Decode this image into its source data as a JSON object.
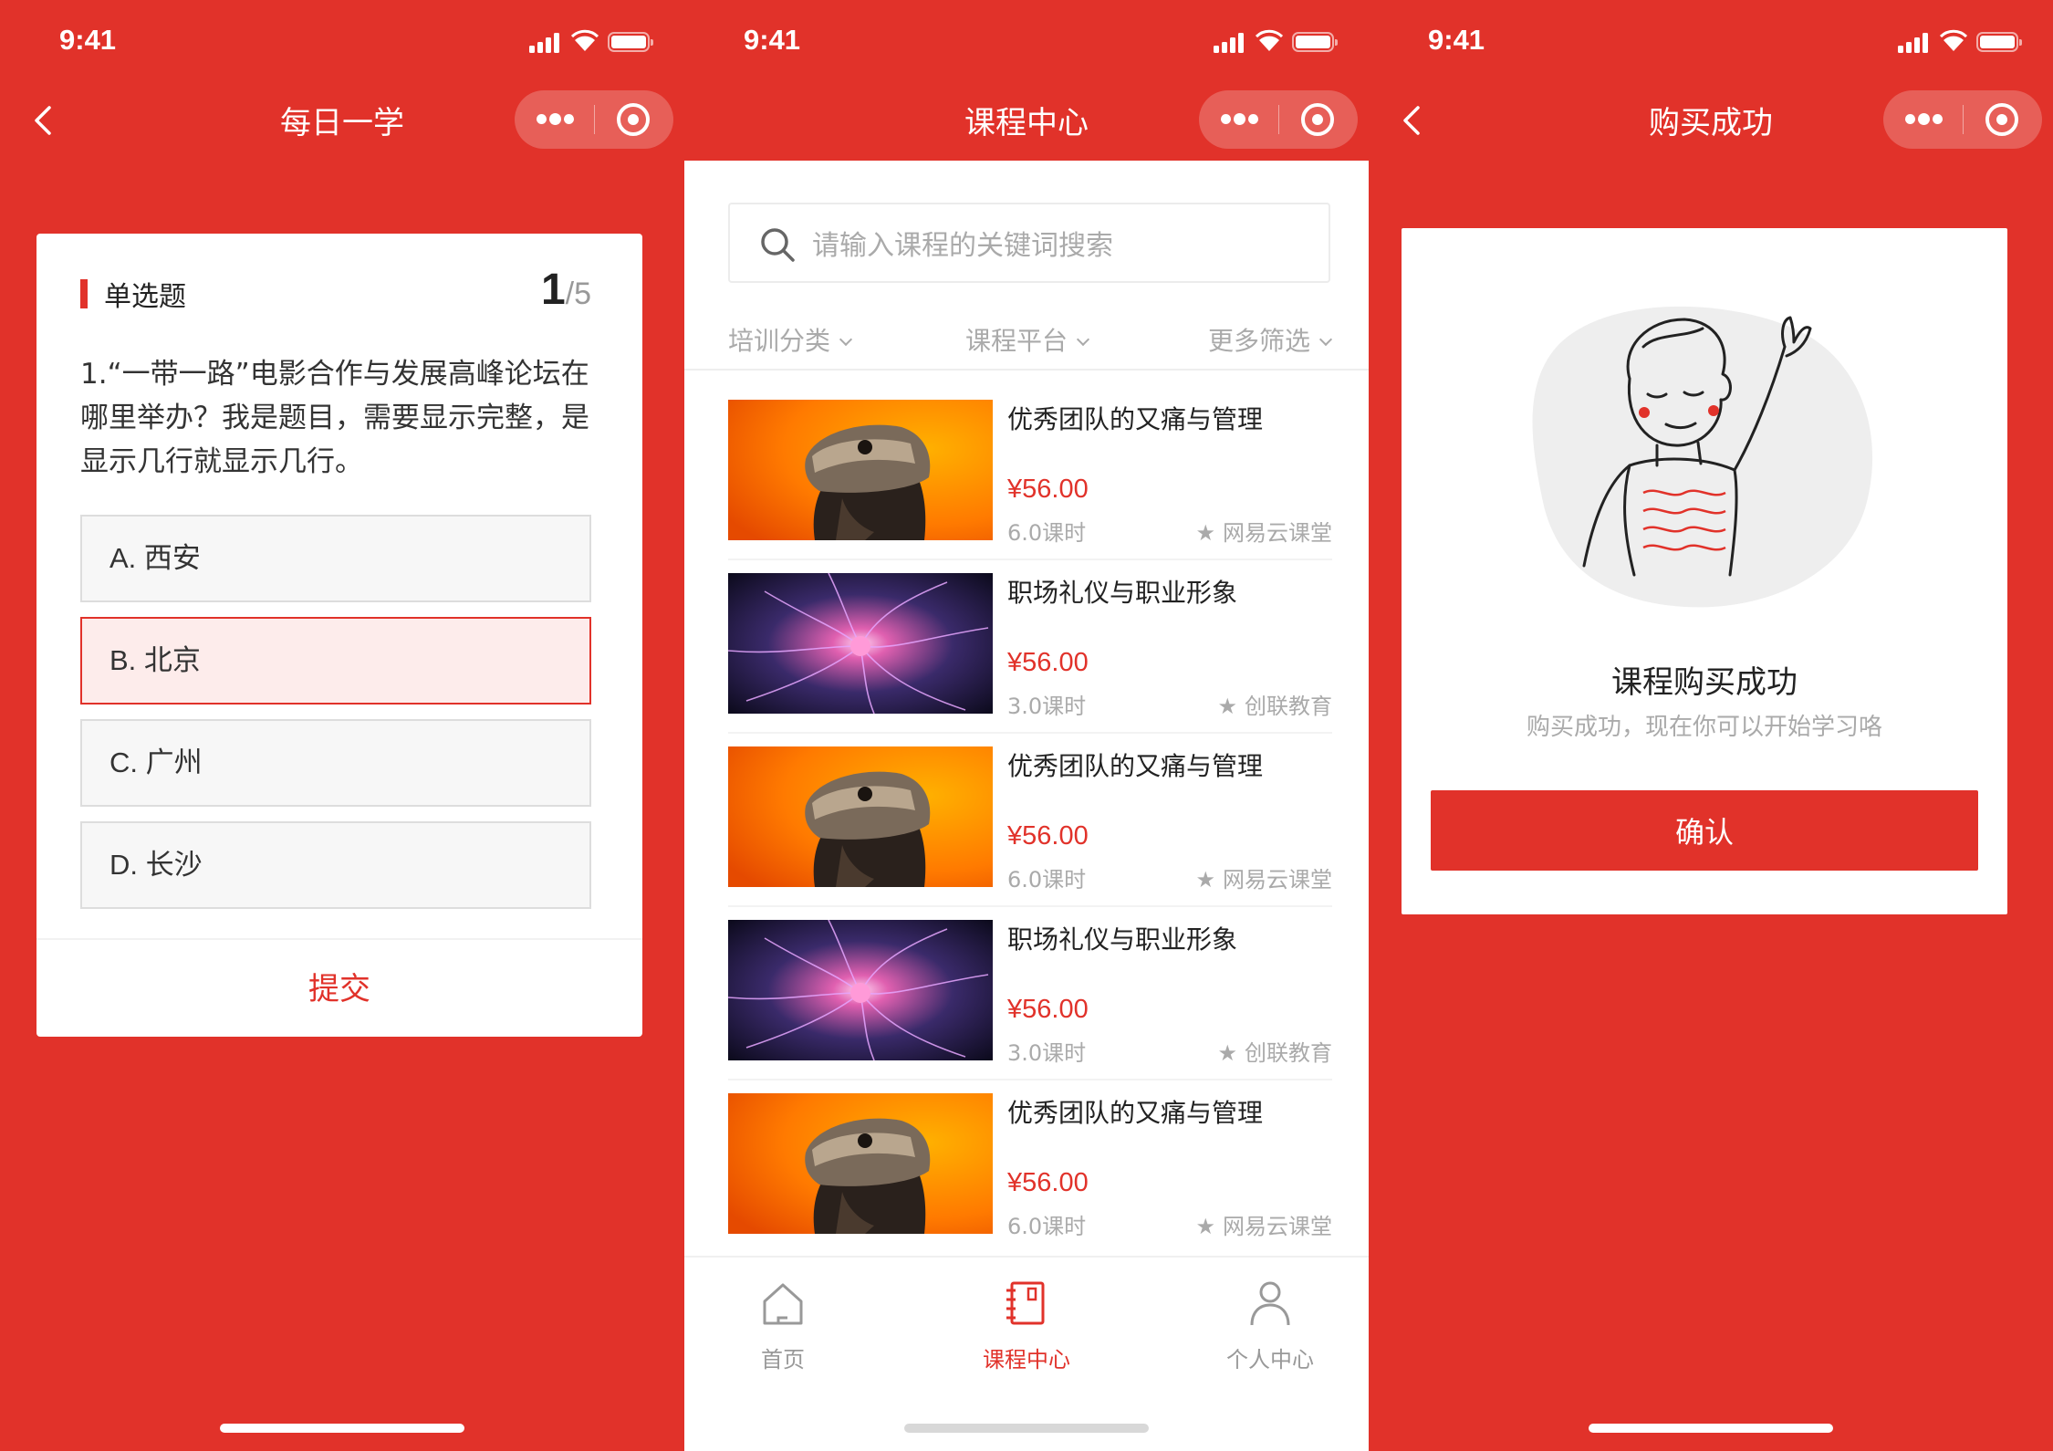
{
  "colors": {
    "brand": "#e1322a",
    "selected_bg": "#fdeceb",
    "muted": "#aaaaaa"
  },
  "screens": [
    {
      "status": {
        "time": "9:41"
      },
      "nav": {
        "title": "每日一学"
      },
      "quiz": {
        "type_label": "单选题",
        "progress_current": "1",
        "progress_total": "/5",
        "question": "1.“一带一路”电影合作与发展高峰论坛在哪里举办？我是题目，需要显示完整，是显示几行就显示几行。",
        "options": [
          {
            "label": "A. 西安",
            "selected": false
          },
          {
            "label": "B. 北京",
            "selected": true
          },
          {
            "label": "C. 广州",
            "selected": false
          },
          {
            "label": "D. 长沙",
            "selected": false
          }
        ],
        "submit_label": "提交"
      }
    },
    {
      "status": {
        "time": "9:41"
      },
      "nav": {
        "title": "课程中心"
      },
      "search": {
        "placeholder": "请输入课程的关键词搜索",
        "icon": "search-icon"
      },
      "filters": [
        {
          "label": "培训分类"
        },
        {
          "label": "课程平台"
        },
        {
          "label": "更多筛选"
        }
      ],
      "courses": [
        {
          "name": "优秀团队的又痛与管理",
          "price": "¥56.00",
          "hours": "6.0课时",
          "platform": "网易云课堂",
          "thumb": "vr-headset"
        },
        {
          "name": "职场礼仪与职业形象",
          "price": "¥56.00",
          "hours": "3.0课时",
          "platform": "创联教育",
          "thumb": "plasma-ball"
        },
        {
          "name": "优秀团队的又痛与管理",
          "price": "¥56.00",
          "hours": "6.0课时",
          "platform": "网易云课堂",
          "thumb": "vr-headset"
        },
        {
          "name": "职场礼仪与职业形象",
          "price": "¥56.00",
          "hours": "3.0课时",
          "platform": "创联教育",
          "thumb": "plasma-ball"
        },
        {
          "name": "优秀团队的又痛与管理",
          "price": "¥56.00",
          "hours": "6.0课时",
          "platform": "网易云课堂",
          "thumb": "vr-headset"
        }
      ],
      "tabbar": [
        {
          "label": "首页",
          "icon": "home-icon",
          "active": false
        },
        {
          "label": "课程中心",
          "icon": "notebook-icon",
          "active": true
        },
        {
          "label": "个人中心",
          "icon": "person-icon",
          "active": false
        }
      ]
    },
    {
      "status": {
        "time": "9:41"
      },
      "nav": {
        "title": "购买成功"
      },
      "success": {
        "title": "课程购买成功",
        "subtitle": "购买成功，现在你可以开始学习咯",
        "confirm_label": "确认"
      }
    }
  ]
}
